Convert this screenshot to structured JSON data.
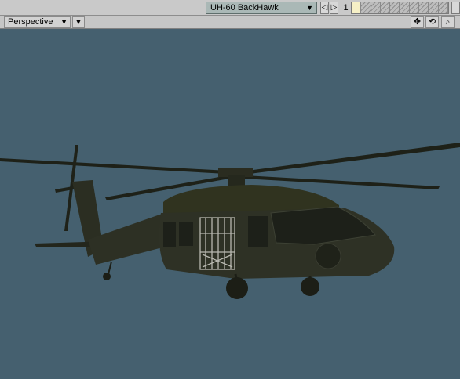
{
  "toolbar": {
    "object_name": "UH-60 BackHawk",
    "prev_glyph": "◁",
    "next_glyph": "▷",
    "frame_number": "1"
  },
  "viewport": {
    "view_mode": "Perspective",
    "tools": [
      {
        "icon": "move-icon",
        "glyph": "✥"
      },
      {
        "icon": "rotate-icon",
        "glyph": "⟲"
      },
      {
        "icon": "zoom-icon",
        "glyph": "🔍"
      }
    ],
    "background_color": "#45606f"
  },
  "colors": {
    "toolbar_bg": "#c9c9c9",
    "selector_bg": "#aab8b6",
    "helicopter_body": "#2b2e22"
  }
}
